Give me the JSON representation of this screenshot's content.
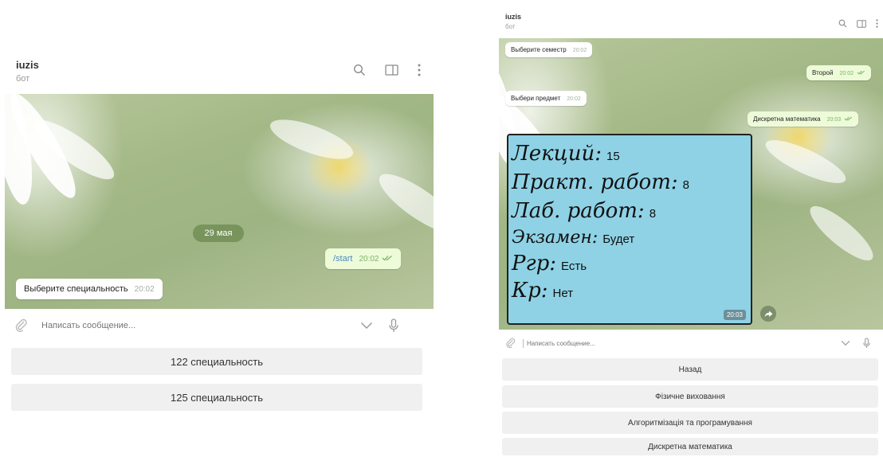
{
  "left": {
    "header": {
      "title": "iuzis",
      "subtitle": "бот"
    },
    "date_pill": "29 мая",
    "messages": [
      {
        "text": "/start",
        "time": "20:02",
        "outgoing": true
      },
      {
        "text": "Выберите специальность",
        "time": "20:02",
        "outgoing": false
      }
    ],
    "input": {
      "placeholder": "Написать сообщение..."
    },
    "keyboard": [
      "122 специальность",
      "125 специальность"
    ]
  },
  "right": {
    "header": {
      "title": "iuzis",
      "subtitle": "бот"
    },
    "messages": [
      {
        "text": "Выберите семестр",
        "time": "20:02",
        "outgoing": false
      },
      {
        "text": "Второй",
        "time": "20:02",
        "outgoing": true
      },
      {
        "text": "Выбери предмет",
        "time": "20:02",
        "outgoing": false
      },
      {
        "text": "Дискретна математика",
        "time": "20:03",
        "outgoing": true
      }
    ],
    "card": {
      "rows": [
        {
          "label": "Лекций:",
          "value": "15"
        },
        {
          "label": "Практ. работ:",
          "value": "8"
        },
        {
          "label": "Лаб. работ:",
          "value": "8"
        },
        {
          "label": "Экзамен:",
          "value": "Будет"
        },
        {
          "label": "Ргр:",
          "value": "Есть"
        },
        {
          "label": "Кр:",
          "value": "Нет"
        }
      ],
      "time": "20:03",
      "background_color": "#8fd2e6"
    },
    "input": {
      "placeholder": "Написать сообщение..."
    },
    "keyboard": [
      "Назад",
      "Фізичне виховання",
      "Алгоритмізація та програмування",
      "Дискретна математика"
    ]
  },
  "icons": [
    "search-icon",
    "sidebar-toggle-icon",
    "more-vertical-icon",
    "paperclip-icon",
    "chevron-down-icon",
    "microphone-icon",
    "double-check-icon",
    "share-icon"
  ],
  "colors": {
    "outgoing_bubble": "#eefbd9",
    "check": "#7db36a",
    "keyboard_button": "#f0f0f0"
  }
}
